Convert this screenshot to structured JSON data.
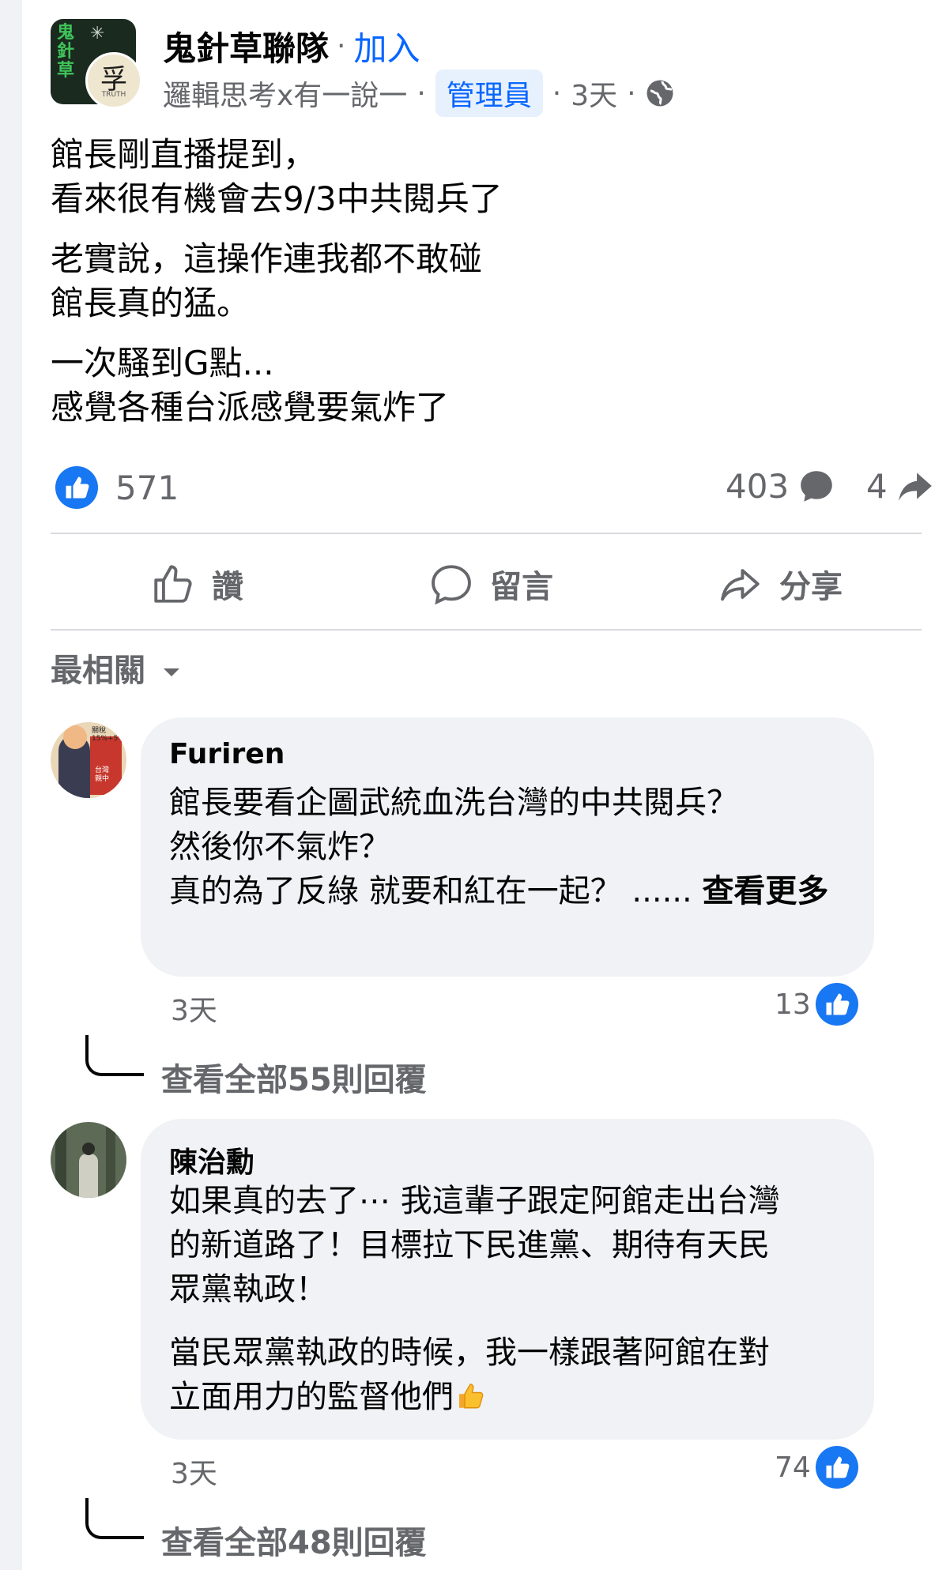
{
  "post": {
    "group_name": "鬼針草聯隊",
    "join_label": "加入",
    "author": "邏輯思考x有一說一",
    "role_badge": "管理員",
    "time": "3天",
    "group_avatar_text": "鬼\n針\n草",
    "author_avatar_text": "孚",
    "author_avatar_subtext": "TRUTH",
    "paragraphs": [
      "館長剛直播提到，\n看來很有機會去9/3中共閱兵了",
      "老實說，這操作連我都不敢碰\n館長真的猛。",
      "一次騷到G點...\n感覺各種台派感覺要氣炸了"
    ],
    "reactions_count": "571",
    "comments_count": "403",
    "shares_count": "4"
  },
  "actions": {
    "like": "讚",
    "comment": "留言",
    "share": "分享"
  },
  "sort_label": "最相關",
  "comments": [
    {
      "author": "Furiren",
      "text": "館長要看企圖武統血洗台灣的中共閱兵？\n然後你不氣炸？\n真的為了反綠 就要和紅在一起？ ......",
      "see_more": "查看更多",
      "time": "3天",
      "likes": "13",
      "replies": "查看全部55則回覆",
      "avatar_texts": [
        "關稅",
        "15%+5",
        "台灣",
        "親中"
      ]
    },
    {
      "author": "陳治勳",
      "paragraphs": [
        "如果真的去了⋯ 我這輩子跟定阿館走出台灣\n的新道路了！目標拉下民進黨、期待有天民\n眾黨執政！",
        "當民眾黨執政的時候，我一樣跟著阿館在對\n立面用力的監督他們"
      ],
      "time": "3天",
      "likes": "74",
      "replies": "查看全部48則回覆"
    }
  ],
  "colors": {
    "accent": "#0866ff",
    "secondary_text": "#65676b",
    "bubble_bg": "#f0f2f5"
  },
  "icons": [
    "globe-icon",
    "like-reaction-icon",
    "comment-icon",
    "share-icon",
    "thumbs-up-icon",
    "chevron-down-icon",
    "thumbs-up-emoji-icon"
  ]
}
